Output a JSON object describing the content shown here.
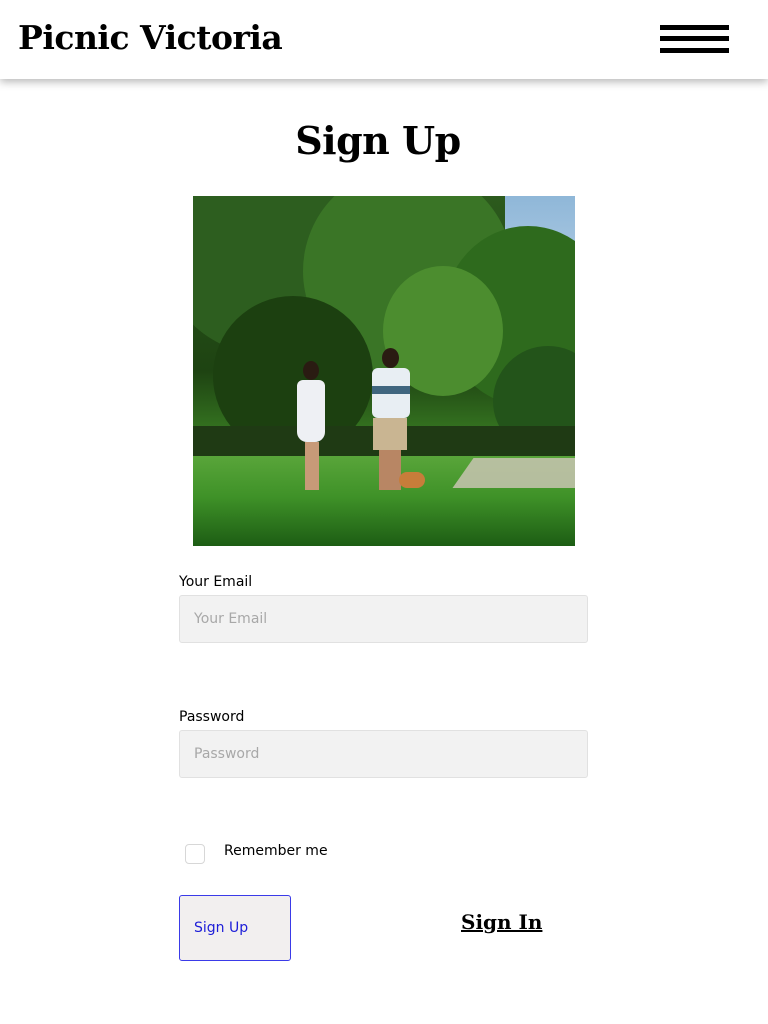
{
  "header": {
    "brand": "Picnic Victoria",
    "menu_icon": "hamburger-menu-icon"
  },
  "main": {
    "title": "Sign Up",
    "image_alt": "Couple walking a corgi in a park"
  },
  "form": {
    "email_label": "Your Email",
    "email_placeholder": "Your Email",
    "email_value": "",
    "password_label": "Password",
    "password_placeholder": "Password",
    "password_value": "",
    "remember_label": "Remember me",
    "remember_checked": false,
    "submit_label": "Sign Up",
    "signin_label": "Sign In"
  },
  "colors": {
    "button_border": "#3a3ae8",
    "button_text": "#1c1cd8",
    "button_bg": "#f2efef",
    "field_bg": "#f2f2f2"
  }
}
